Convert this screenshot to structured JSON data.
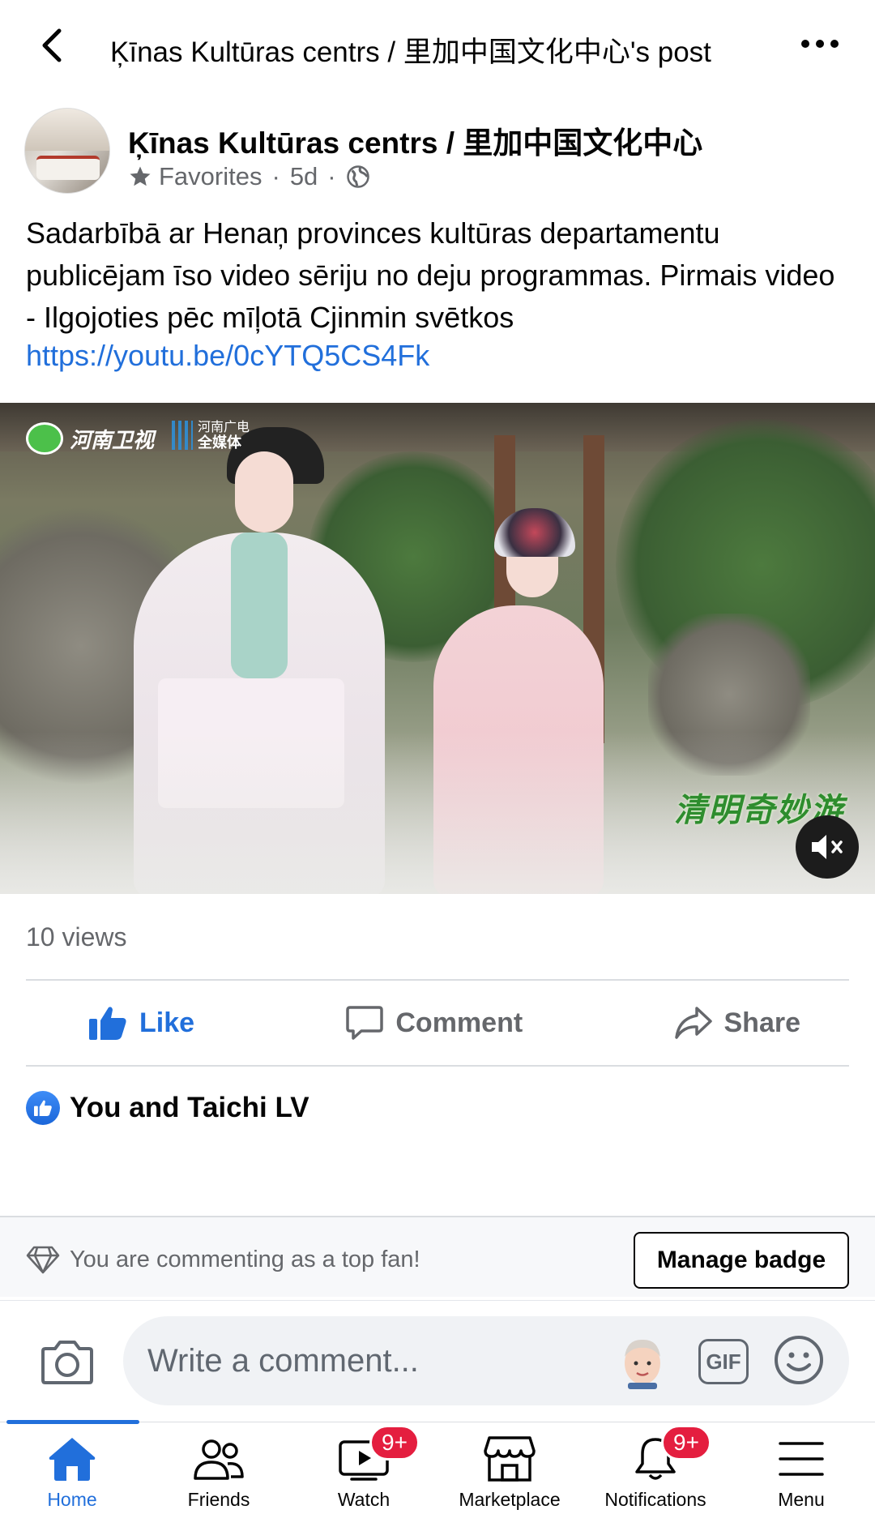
{
  "header": {
    "title": "Ķīnas Kultūras centrs / 里加中国文化中心's post"
  },
  "post": {
    "page_name": "Ķīnas Kultūras centrs / 里加中国文化中心",
    "category": "Favorites",
    "time": "5d",
    "dot": "·",
    "text": "Sadarbībā ar Henaņ provinces kultūras departamentu publicējam īso video sēriju no deju programmas. Pirmais video - Ilgojoties pēc mīļotā Cjinmin svētkos",
    "link": "https://youtu.be/0cYTQ5CS4Fk"
  },
  "video": {
    "watermark_1": "河南卫视",
    "watermark_2_line1": "河南广电",
    "watermark_2_line2": "全媒体",
    "watermark_3": "清明奇妙游"
  },
  "stats": {
    "views": "10 views"
  },
  "actions": {
    "like": "Like",
    "comment": "Comment",
    "share": "Share"
  },
  "reactions": {
    "text": "You and Taichi LV"
  },
  "top_fan": {
    "text": "You are commenting as a top fan!",
    "manage_badge": "Manage badge"
  },
  "composer": {
    "placeholder": "Write a comment...",
    "gif_label": "GIF"
  },
  "bottom_nav": {
    "items": [
      {
        "label": "Home",
        "icon": "home-icon"
      },
      {
        "label": "Friends",
        "icon": "friends-icon"
      },
      {
        "label": "Watch",
        "icon": "watch-icon",
        "badge": "9+"
      },
      {
        "label": "Marketplace",
        "icon": "marketplace-icon"
      },
      {
        "label": "Notifications",
        "icon": "notifications-icon",
        "badge": "9+"
      },
      {
        "label": "Menu",
        "icon": "menu-icon"
      }
    ]
  },
  "colors": {
    "accent": "#216fdb",
    "secondary_text": "#65676b",
    "badge": "#e41e3f"
  }
}
